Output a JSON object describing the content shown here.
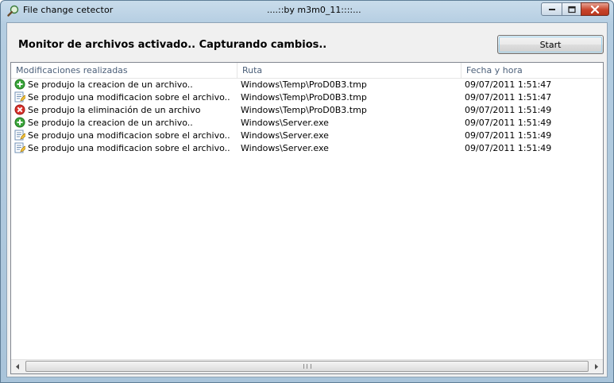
{
  "window": {
    "title": "File change cetector",
    "subtitle": "....::by m3m0_11::::..."
  },
  "status_text": "Monitor de archivos activado.. Capturando cambios..",
  "start_label": "Start",
  "columns": [
    "Modificaciones realizadas",
    "Ruta",
    "Fecha y hora"
  ],
  "rows": [
    {
      "icon": "create-icon",
      "action": "Se produjo la creacion de un archivo..",
      "path": "Windows\\Temp\\ProD0B3.tmp",
      "datetime": "09/07/2011 1:51:47"
    },
    {
      "icon": "modify-icon",
      "action": "Se produjo una modificacion sobre el archivo..",
      "path": "Windows\\Temp\\ProD0B3.tmp",
      "datetime": "09/07/2011 1:51:47"
    },
    {
      "icon": "delete-icon",
      "action": "Se produjo la eliminación de un archivo",
      "path": "Windows\\Temp\\ProD0B3.tmp",
      "datetime": "09/07/2011 1:51:49"
    },
    {
      "icon": "create-icon",
      "action": "Se produjo la creacion de un archivo..",
      "path": "Windows\\Server.exe",
      "datetime": "09/07/2011 1:51:49"
    },
    {
      "icon": "modify-icon",
      "action": "Se produjo una modificacion sobre el archivo..",
      "path": "Windows\\Server.exe",
      "datetime": "09/07/2011 1:51:49"
    },
    {
      "icon": "modify-icon",
      "action": "Se produjo una modificacion sobre el archivo..",
      "path": "Windows\\Server.exe",
      "datetime": "09/07/2011 1:51:49"
    }
  ],
  "colors": {
    "create": "#3aa63a",
    "delete": "#d9302a",
    "accent": "#4c607a"
  }
}
